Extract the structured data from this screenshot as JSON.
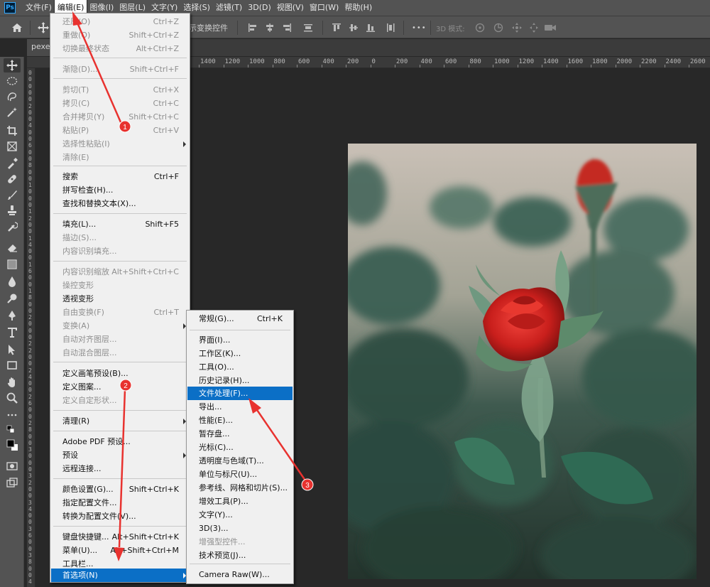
{
  "menubar": {
    "logo": "Ps",
    "items": [
      "文件(F)",
      "编辑(E)",
      "图像(I)",
      "图层(L)",
      "文字(Y)",
      "选择(S)",
      "滤镜(T)",
      "3D(D)",
      "视图(V)",
      "窗口(W)",
      "帮助(H)"
    ]
  },
  "optionsbar": {
    "transform_label": "示变换控件",
    "mode_3d_label": "3D 模式:",
    "more": "•••"
  },
  "tab": {
    "label": "pexel"
  },
  "ruler": {
    "h_labels": [
      "1400",
      "1200",
      "1000",
      "800",
      "600",
      "400",
      "200",
      "0",
      "200",
      "400",
      "600",
      "800",
      "1000",
      "1200",
      "1400",
      "1600",
      "1800",
      "2000",
      "2200",
      "2400",
      "2600",
      "2800",
      "3000"
    ],
    "v_labels": [
      "0",
      "0",
      "0",
      "0",
      "0",
      "2",
      "0",
      "0",
      "4",
      "0",
      "0",
      "6",
      "0",
      "0",
      "8",
      "0",
      "0",
      "1",
      "0",
      "0",
      "0",
      "1",
      "2",
      "0",
      "0",
      "1",
      "4",
      "0",
      "0",
      "1",
      "6",
      "0",
      "0",
      "1",
      "8",
      "0",
      "0",
      "2",
      "0",
      "0",
      "0",
      "2",
      "2",
      "0",
      "0",
      "2",
      "4",
      "0",
      "0",
      "2",
      "6",
      "0",
      "0",
      "2",
      "8",
      "0",
      "0",
      "3",
      "0",
      "0",
      "0",
      "3",
      "2",
      "0",
      "0",
      "3",
      "4",
      "0",
      "0",
      "3",
      "6",
      "0",
      "0",
      "3",
      "8",
      "0",
      "0",
      "4",
      "0",
      "0"
    ]
  },
  "tools": [
    "move-tool",
    "marquee-tool",
    "lasso-tool",
    "magic-wand-tool",
    "crop-tool",
    "frame-tool",
    "eyedropper-tool",
    "healing-brush-tool",
    "brush-tool",
    "clone-stamp-tool",
    "history-brush-tool",
    "eraser-tool",
    "gradient-tool",
    "blur-tool",
    "dodge-tool",
    "pen-tool",
    "type-tool",
    "path-selection-tool",
    "rectangle-tool",
    "hand-tool",
    "zoom-tool",
    "more-tools",
    "default-colors",
    "color-swatches",
    "quick-mask",
    "screen-mode"
  ],
  "edit_menu": {
    "items": [
      {
        "label": "还原(O)",
        "shortcut": "Ctrl+Z",
        "disabled": true
      },
      {
        "label": "重做(O)",
        "shortcut": "Shift+Ctrl+Z",
        "disabled": true
      },
      {
        "label": "切换最终状态",
        "shortcut": "Alt+Ctrl+Z",
        "disabled": true
      },
      {
        "label": "渐隐(D)...",
        "shortcut": "Shift+Ctrl+F",
        "disabled": true
      },
      {
        "label": "剪切(T)",
        "shortcut": "Ctrl+X",
        "disabled": true
      },
      {
        "label": "拷贝(C)",
        "shortcut": "Ctrl+C",
        "disabled": true
      },
      {
        "label": "合并拷贝(Y)",
        "shortcut": "Shift+Ctrl+C",
        "disabled": true
      },
      {
        "label": "粘贴(P)",
        "shortcut": "Ctrl+V",
        "disabled": true
      },
      {
        "label": "选择性粘贴(I)",
        "shortcut": "",
        "disabled": true,
        "submenu": true
      },
      {
        "label": "清除(E)",
        "shortcut": "",
        "disabled": true
      },
      {
        "label": "搜索",
        "shortcut": "Ctrl+F",
        "disabled": false
      },
      {
        "label": "拼写检查(H)...",
        "shortcut": "",
        "disabled": false
      },
      {
        "label": "查找和替换文本(X)...",
        "shortcut": "",
        "disabled": false
      },
      {
        "label": "填充(L)...",
        "shortcut": "Shift+F5",
        "disabled": false
      },
      {
        "label": "描边(S)...",
        "shortcut": "",
        "disabled": true
      },
      {
        "label": "内容识别填充...",
        "shortcut": "",
        "disabled": true
      },
      {
        "label": "内容识别缩放",
        "shortcut": "Alt+Shift+Ctrl+C",
        "disabled": true
      },
      {
        "label": "操控变形",
        "shortcut": "",
        "disabled": true
      },
      {
        "label": "透视变形",
        "shortcut": "",
        "disabled": false
      },
      {
        "label": "自由变换(F)",
        "shortcut": "Ctrl+T",
        "disabled": true
      },
      {
        "label": "变换(A)",
        "shortcut": "",
        "disabled": true,
        "submenu": true
      },
      {
        "label": "自动对齐图层...",
        "shortcut": "",
        "disabled": true
      },
      {
        "label": "自动混合图层...",
        "shortcut": "",
        "disabled": true
      },
      {
        "label": "定义画笔预设(B)...",
        "shortcut": "",
        "disabled": false
      },
      {
        "label": "定义图案...",
        "shortcut": "",
        "disabled": false
      },
      {
        "label": "定义自定形状...",
        "shortcut": "",
        "disabled": true
      },
      {
        "label": "清理(R)",
        "shortcut": "",
        "disabled": false,
        "submenu": true
      },
      {
        "label": "Adobe PDF 预设...",
        "shortcut": "",
        "disabled": false
      },
      {
        "label": "预设",
        "shortcut": "",
        "disabled": false,
        "submenu": true
      },
      {
        "label": "远程连接...",
        "shortcut": "",
        "disabled": false
      },
      {
        "label": "颜色设置(G)...",
        "shortcut": "Shift+Ctrl+K",
        "disabled": false
      },
      {
        "label": "指定配置文件...",
        "shortcut": "",
        "disabled": false
      },
      {
        "label": "转换为配置文件(V)...",
        "shortcut": "",
        "disabled": false
      },
      {
        "label": "键盘快捷键...",
        "shortcut": "Alt+Shift+Ctrl+K",
        "disabled": false
      },
      {
        "label": "菜单(U)...",
        "shortcut": "Alt+Shift+Ctrl+M",
        "disabled": false
      },
      {
        "label": "工具栏...",
        "shortcut": "",
        "disabled": false
      },
      {
        "label": "首选项(N)",
        "shortcut": "",
        "disabled": false,
        "submenu": true,
        "highlighted": true
      }
    ]
  },
  "prefs_menu": {
    "items": [
      {
        "label": "常规(G)...",
        "shortcut": "Ctrl+K",
        "disabled": false
      },
      {
        "label": "界面(I)...",
        "shortcut": "",
        "disabled": false
      },
      {
        "label": "工作区(K)...",
        "shortcut": "",
        "disabled": false
      },
      {
        "label": "工具(O)...",
        "shortcut": "",
        "disabled": false
      },
      {
        "label": "历史记录(H)...",
        "shortcut": "",
        "disabled": false
      },
      {
        "label": "文件处理(F)...",
        "shortcut": "",
        "disabled": false,
        "highlighted": true
      },
      {
        "label": "导出...",
        "shortcut": "",
        "disabled": false
      },
      {
        "label": "性能(E)...",
        "shortcut": "",
        "disabled": false
      },
      {
        "label": "暂存盘...",
        "shortcut": "",
        "disabled": false
      },
      {
        "label": "光标(C)...",
        "shortcut": "",
        "disabled": false
      },
      {
        "label": "透明度与色域(T)...",
        "shortcut": "",
        "disabled": false
      },
      {
        "label": "单位与标尺(U)...",
        "shortcut": "",
        "disabled": false
      },
      {
        "label": "参考线、网格和切片(S)...",
        "shortcut": "",
        "disabled": false
      },
      {
        "label": "增效工具(P)...",
        "shortcut": "",
        "disabled": false
      },
      {
        "label": "文字(Y)...",
        "shortcut": "",
        "disabled": false
      },
      {
        "label": "3D(3)...",
        "shortcut": "",
        "disabled": false
      },
      {
        "label": "增强型控件...",
        "shortcut": "",
        "disabled": true
      },
      {
        "label": "技术预览(J)...",
        "shortcut": "",
        "disabled": false
      },
      {
        "label": "Camera Raw(W)...",
        "shortcut": "",
        "disabled": false
      }
    ]
  },
  "annotations": [
    "1",
    "2",
    "3"
  ],
  "colors": {
    "accent": "#0b6fc6",
    "annotation": "#e8322f",
    "menu_bg": "#f0f0f0",
    "chrome": "#535353",
    "canvas": "#282828"
  }
}
